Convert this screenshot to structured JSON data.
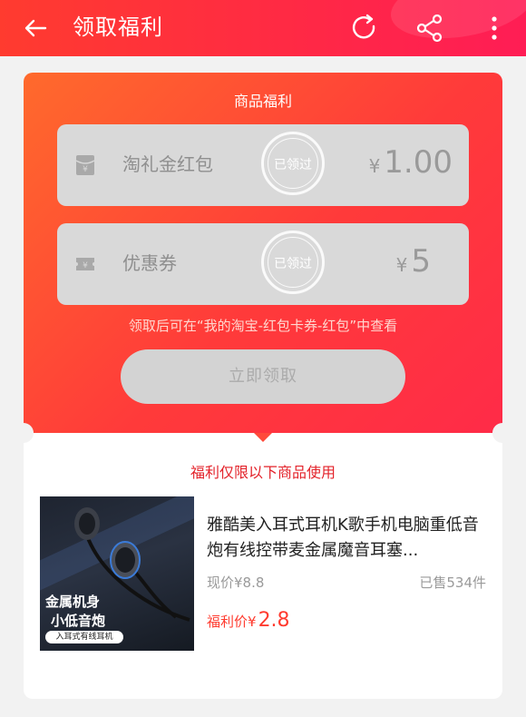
{
  "topbar": {
    "title": "领取福利",
    "icons": [
      "back-arrow-icon",
      "refresh-icon",
      "share-icon",
      "more-icon"
    ]
  },
  "welfare": {
    "header": "商品福利",
    "coupons": [
      {
        "label": "淘礼金红包",
        "stamp": "已领过",
        "currency": "¥",
        "value": "1.00",
        "icon": "red-envelope-icon"
      },
      {
        "label": "优惠券",
        "stamp": "已领过",
        "currency": "¥",
        "value": "5",
        "icon": "coupon-ticket-icon"
      }
    ],
    "hint": "领取后可在“我的淘宝-红包卡券-红包”中查看",
    "claim_button": "立即领取"
  },
  "limit_text": "福利仅限以下商品使用",
  "product": {
    "name": "雅酷美入耳式耳机K歌手机电脑重低音炮有线控带麦金属魔音耳塞...",
    "current_price_label": "现价",
    "current_price": "¥8.8",
    "sold": "已售534件",
    "welfare_price_label": "福利价",
    "welfare_price_currency": "¥",
    "welfare_price": "2.8",
    "image_text_line1": "金属机身",
    "image_text_line2": "小低音炮",
    "image_tag": "入耳式有线耳机"
  },
  "colors": {
    "brand_red": "#ff2846",
    "price_red": "#ff3b2f"
  }
}
